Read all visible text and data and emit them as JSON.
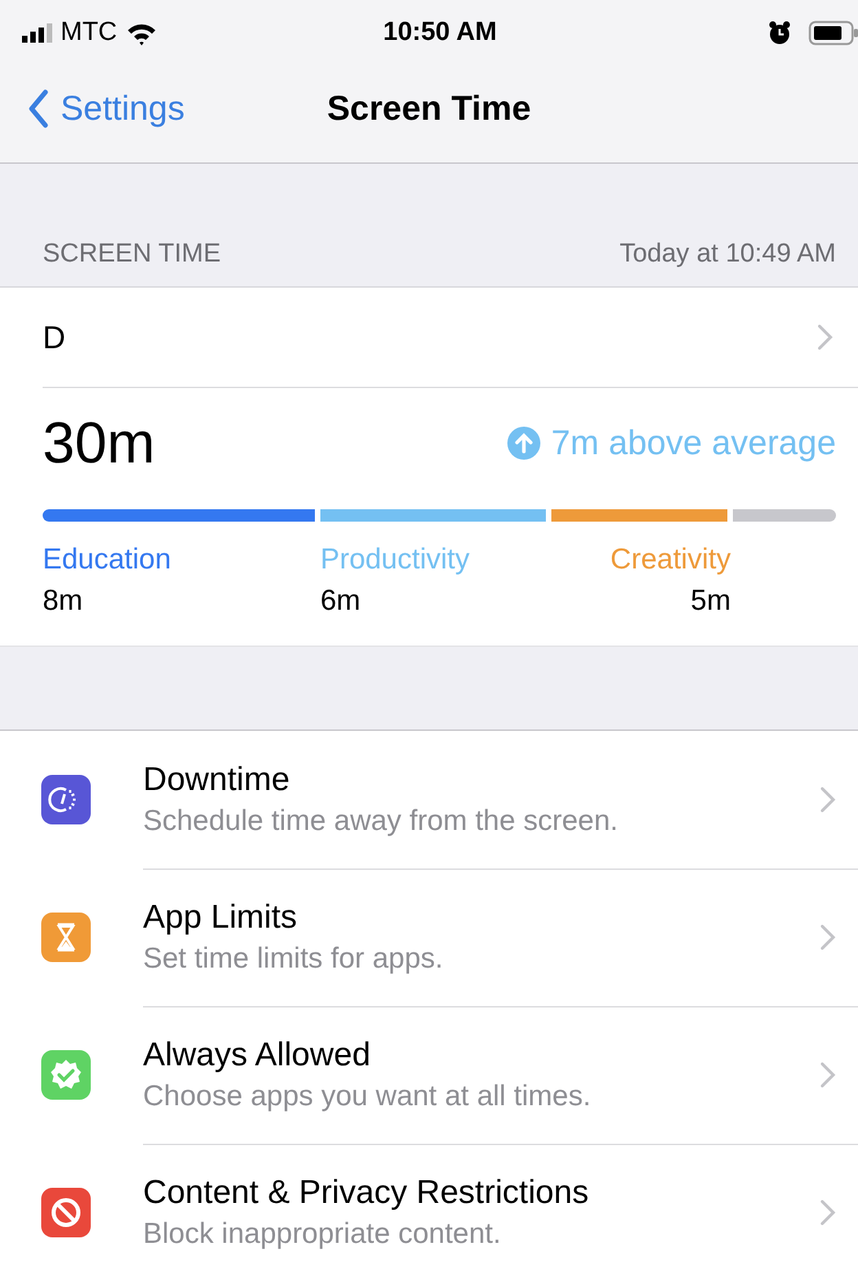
{
  "status_bar": {
    "carrier": "MTC",
    "time": "10:50 AM"
  },
  "nav": {
    "back": "Settings",
    "title": "Screen Time"
  },
  "section": {
    "header": "SCREEN TIME",
    "updated": "Today at 10:49 AM"
  },
  "device": {
    "name": "D"
  },
  "summary": {
    "total": "30m",
    "trend": "7m above average",
    "segments": [
      {
        "label": "Education",
        "value": "8m",
        "color": "#3478f0"
      },
      {
        "label": "Productivity",
        "value": "6m",
        "color": "#74c0f2"
      },
      {
        "label": "Creativity",
        "value": "5m",
        "color": "#ee9a3a"
      },
      {
        "color": "#c7c7cc"
      }
    ]
  },
  "items": [
    {
      "kind": "downtime",
      "title": "Downtime",
      "subtitle": "Schedule time away from the screen.",
      "color": "#5856d6"
    },
    {
      "kind": "limits",
      "title": "App Limits",
      "subtitle": "Set time limits for apps.",
      "color": "#f09a37"
    },
    {
      "kind": "allowed",
      "title": "Always Allowed",
      "subtitle": "Choose apps you want at all times.",
      "color": "#5fd364"
    },
    {
      "kind": "restrict",
      "title": "Content & Privacy Restrictions",
      "subtitle": "Block inappropriate content.",
      "color": "#e9483b"
    }
  ]
}
